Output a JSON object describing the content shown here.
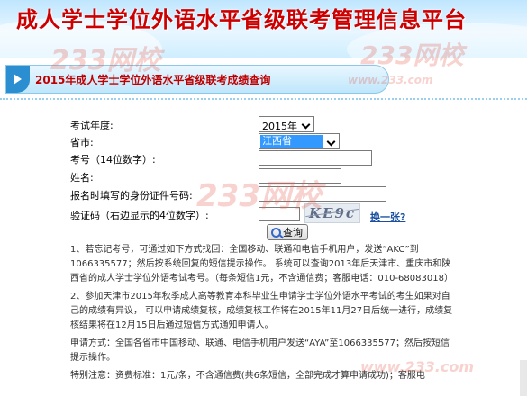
{
  "header": {
    "title": "成人学士学位外语水平省级联考管理信息平台"
  },
  "watermark": {
    "text": "233网校",
    "domain": "www.233.com"
  },
  "subtitle": {
    "title": "2015年成人学士学位外语水平省级联考成绩查询"
  },
  "form": {
    "year_label": "考试年度:",
    "year_value": "2015年",
    "province_label": "省市:",
    "province_value": "江西省",
    "exam_no_label": "考号（14位数字）:",
    "name_label": "姓名:",
    "id_label": "报名时填写的身份证件号码:",
    "captcha_label": "验证码（右边显示的4位数字）:",
    "captcha_text": "KE9c",
    "refresh_label": "换一张?",
    "query_label": "查询"
  },
  "notes": [
    "1、若忘记考号，可通过如下方式找回：全国移动、联通和电信手机用户，发送“AKC”到1066335577；然后按系统回复的短信提示操作。 系统可以查询2013年后天津市、重庆市和陕西省的成人学士学位外语考试考号。（每条短信1元，不含通信费；客服电话：010-68083018）",
    "2、参加天津市2015年秋季成人高等教育本科毕业生申请学士学位外语水平考试的考生如果对自己的成绩有异议， 可以申请成绩复核，成绩复核工作将在2015年11月27日后统一进行，成绩复核结果将在12月15日后通过短信方式通知申请人。",
    "申请方式：全国各省市中国移动、联通、电信手机用户发送“AYA”至1066335577；然后按短信提示操作。",
    "特别注意：资费标准：1元/条，不含通信费(共6条短信，全部完成才算申请成功)；客服电"
  ]
}
